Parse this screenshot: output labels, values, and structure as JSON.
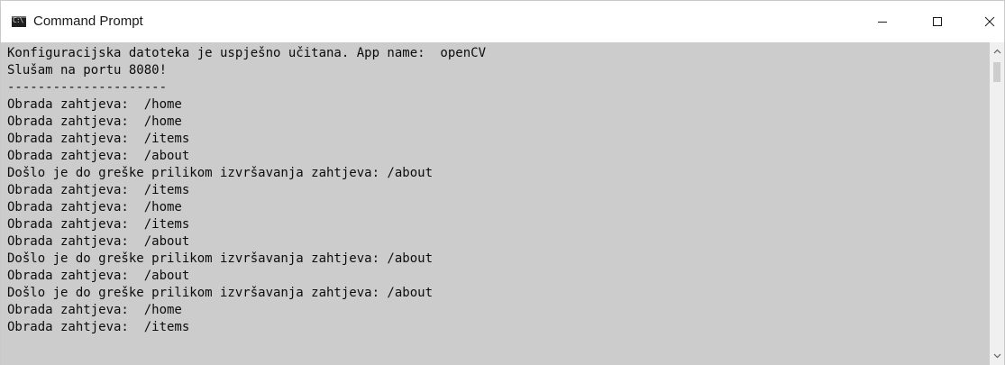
{
  "window": {
    "title": "Command Prompt",
    "icon": "command-prompt-icon",
    "icon_glyph": "C:\\"
  },
  "controls": {
    "minimize_icon": "minimize-icon",
    "maximize_icon": "maximize-icon",
    "close_icon": "close-icon"
  },
  "console": {
    "background": "#cccccc",
    "foreground": "#0c0c0c",
    "lines": [
      "Konfiguracijska datoteka je uspješno učitana. App name:  openCV",
      "Slušam na portu 8080!",
      "---------------------",
      "Obrada zahtjeva:  /home",
      "Obrada zahtjeva:  /home",
      "Obrada zahtjeva:  /items",
      "Obrada zahtjeva:  /about",
      "Došlo je do greške prilikom izvršavanja zahtjeva: /about",
      "Obrada zahtjeva:  /items",
      "Obrada zahtjeva:  /home",
      "Obrada zahtjeva:  /items",
      "Obrada zahtjeva:  /about",
      "Došlo je do greške prilikom izvršavanja zahtjeva: /about",
      "Obrada zahtjeva:  /about",
      "Došlo je do greške prilikom izvršavanja zahtjeva: /about",
      "Obrada zahtjeva:  /home",
      "Obrada zahtjeva:  /items"
    ]
  },
  "scrollbar": {
    "up_icon": "scroll-up-arrow-icon",
    "down_icon": "scroll-down-arrow-icon"
  }
}
